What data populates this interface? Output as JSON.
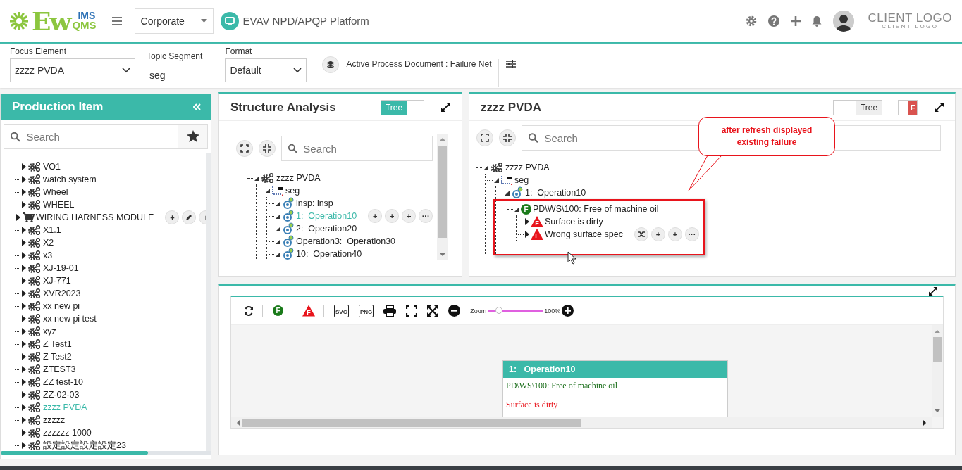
{
  "header": {
    "logo": {
      "main": "Ew",
      "top": "IMS",
      "bottom": "QMS"
    },
    "company": "Corporate",
    "platform": "EVAV NPD/APQP Platform",
    "client_logo": {
      "title": "CLIENT LOGO",
      "subtitle": "CLIENT LOGO"
    }
  },
  "toolbar": {
    "focus_element": {
      "label": "Focus Element",
      "value": "zzzz PVDA"
    },
    "topic_segment": {
      "label": "Topic Segment",
      "value": "seg"
    },
    "format": {
      "label": "Format",
      "value": "Default"
    },
    "active_document": "Active Process Document : Failure Net"
  },
  "sidebar": {
    "title": "Production Item",
    "search": {
      "placeholder": "Search"
    },
    "items": [
      {
        "label": "VO1",
        "kind": "gears",
        "expanded": false,
        "selected": false
      },
      {
        "label": "watch system",
        "kind": "gears",
        "expanded": false,
        "selected": false
      },
      {
        "label": "Wheel",
        "kind": "gears",
        "expanded": false,
        "selected": false
      },
      {
        "label": "WHEEL",
        "kind": "gears",
        "expanded": false,
        "selected": false
      },
      {
        "label": "WIRING HARNESS MODULE",
        "kind": "cart",
        "expanded": false,
        "selected": false,
        "actions": [
          {
            "kind": "glyph",
            "glyph": "+"
          },
          {
            "kind": "edit"
          },
          {
            "kind": "glyph",
            "glyph": "i"
          }
        ]
      },
      {
        "label": "X1.1",
        "kind": "gears",
        "expanded": false,
        "selected": false
      },
      {
        "label": "X2",
        "kind": "gears",
        "expanded": false,
        "selected": false
      },
      {
        "label": "x3",
        "kind": "gears",
        "expanded": false,
        "selected": false
      },
      {
        "label": "XJ-19-01",
        "kind": "gears",
        "expanded": false,
        "selected": false
      },
      {
        "label": "XJ-771",
        "kind": "gears",
        "expanded": false,
        "selected": false
      },
      {
        "label": "XVR2023",
        "kind": "gears",
        "expanded": false,
        "selected": false
      },
      {
        "label": "xx new pi",
        "kind": "gears",
        "expanded": false,
        "selected": false
      },
      {
        "label": "xx new pi test",
        "kind": "gears",
        "expanded": false,
        "selected": false
      },
      {
        "label": "xyz",
        "kind": "gears",
        "expanded": false,
        "selected": false
      },
      {
        "label": "Z Test1",
        "kind": "gears",
        "expanded": false,
        "selected": false
      },
      {
        "label": "Z Test2",
        "kind": "gears",
        "expanded": false,
        "selected": false
      },
      {
        "label": "ZTEST3",
        "kind": "gears",
        "expanded": false,
        "selected": false
      },
      {
        "label": "ZZ test-10",
        "kind": "gears",
        "expanded": false,
        "selected": false
      },
      {
        "label": "ZZ-02-03",
        "kind": "gears",
        "expanded": false,
        "selected": false
      },
      {
        "label": "zzzz PVDA",
        "kind": "gears",
        "expanded": false,
        "selected": true
      },
      {
        "label": "zzzzz",
        "kind": "gears",
        "expanded": false,
        "selected": false
      },
      {
        "label": "zzzzzz 1000",
        "kind": "gears",
        "expanded": false,
        "selected": false
      },
      {
        "label": "設定設定設定設定23",
        "kind": "gears",
        "expanded": false,
        "selected": false
      }
    ]
  },
  "structure": {
    "title": "Structure Analysis",
    "toggle": {
      "label": "Tree",
      "on": true
    },
    "search": {
      "placeholder": "Search"
    },
    "tree": [
      {
        "label": "zzzz PVDA",
        "kind": "gears",
        "expanded": true,
        "selected": false,
        "children": [
          {
            "label": "seg",
            "kind": "segment",
            "expanded": true,
            "selected": false,
            "children": [
              {
                "label": "insp: insp",
                "kind": "operation",
                "expanded": true,
                "selected": false
              },
              {
                "label": "1:  Operation10",
                "kind": "operation",
                "expanded": true,
                "selected": true,
                "actions": [
                  {
                    "kind": "glyph",
                    "glyph": "+"
                  },
                  {
                    "kind": "glyph",
                    "glyph": "+"
                  },
                  {
                    "kind": "glyph",
                    "glyph": "+"
                  },
                  {
                    "kind": "glyph",
                    "glyph": "···"
                  }
                ]
              },
              {
                "label": "2:  Operation20",
                "kind": "operation",
                "expanded": true,
                "selected": false
              },
              {
                "label": "Operation3:  Operation30",
                "kind": "operation",
                "expanded": true,
                "selected": false
              },
              {
                "label": "10:  Operation40",
                "kind": "operation",
                "expanded": true,
                "selected": false
              }
            ]
          }
        ]
      }
    ]
  },
  "detail": {
    "title": "zzzz PVDA",
    "tree_toggle": {
      "label": "Tree",
      "on": false
    },
    "failure_toggle": {
      "label": "F",
      "on": true
    },
    "search": {
      "placeholder": "Search"
    },
    "callout": "after refresh displayed existing failure",
    "tree": [
      {
        "label": "zzzz PVDA",
        "kind": "gears",
        "expanded": true,
        "selected": false,
        "children": [
          {
            "label": "seg",
            "kind": "segment",
            "expanded": true,
            "selected": false,
            "children": [
              {
                "label": "1:  Operation10",
                "kind": "operation",
                "expanded": true,
                "selected": false,
                "highlighted": true,
                "children": [
                  {
                    "label": "PD\\WS\\100: Free of machine oil",
                    "kind": "function",
                    "badge": "F",
                    "expanded": true,
                    "selected": false,
                    "children": [
                      {
                        "label": "Surface is dirty",
                        "kind": "failure",
                        "badge": "F",
                        "expanded": false,
                        "selected": false
                      },
                      {
                        "label": "Wrong surface spec",
                        "kind": "failure",
                        "badge": "F",
                        "expanded": false,
                        "selected": false,
                        "actions": [
                          {
                            "kind": "shuffle"
                          },
                          {
                            "kind": "glyph",
                            "glyph": "+"
                          },
                          {
                            "kind": "glyph",
                            "glyph": "+"
                          },
                          {
                            "kind": "glyph",
                            "glyph": "···"
                          }
                        ]
                      }
                    ]
                  }
                ]
              }
            ]
          }
        ]
      }
    ]
  },
  "diagram": {
    "tools": [
      {
        "kind": "refresh"
      },
      {
        "kind": "function",
        "glyph": "F"
      },
      {
        "kind": "failure",
        "glyph": "F"
      },
      {
        "kind": "export",
        "glyph": "SVG"
      },
      {
        "kind": "export",
        "glyph": "PNG"
      },
      {
        "kind": "print"
      },
      {
        "kind": "fit"
      },
      {
        "kind": "expand"
      },
      {
        "kind": "zoom-out"
      }
    ],
    "zoom": {
      "label": "Zoom",
      "level": 0.2,
      "reading": "100%"
    },
    "card": {
      "title": "1:   Operation10",
      "lines": [
        {
          "kind": "function",
          "text": "PD\\WS\\100: Free of machine oil"
        },
        {
          "kind": "failure",
          "text": "Surface is dirty"
        }
      ]
    }
  }
}
